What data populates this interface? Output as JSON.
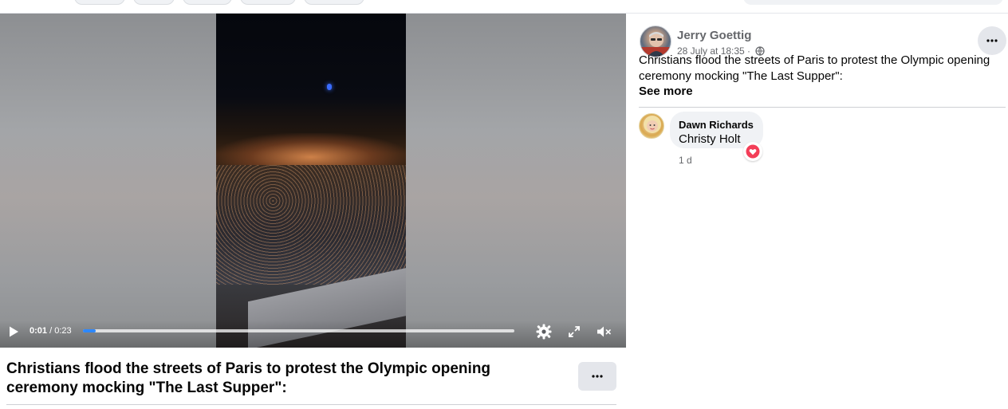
{
  "video": {
    "current_time": "0:01",
    "separator": "/",
    "duration": "0:23",
    "progress_fraction": 0.03,
    "play_icon": "play-icon",
    "settings_icon": "gear-icon",
    "fullscreen_icon": "fullscreen-icon",
    "mute_icon": "muted-speaker-icon"
  },
  "caption": {
    "text": "Christians flood the streets of Paris to protest the Olympic opening ceremony mocking \"The Last Supper\":",
    "more_icon": "more-dots-icon"
  },
  "post": {
    "author": "Jerry Goettig",
    "timestamp": "28 July at 18:35 ·",
    "privacy_icon": "globe-icon",
    "text": "Christians flood the streets of Paris to protest the Olympic opening ceremony mocking \"The Last Supper\":",
    "see_more": "See more",
    "more_icon": "more-dots-icon"
  },
  "comment": {
    "author": "Dawn Richards",
    "text": "Christy Holt",
    "age": "1 d",
    "reaction_icon": "heart-reaction-icon"
  },
  "colors": {
    "accent": "#2d88ff",
    "secondary_text": "#65676b",
    "bubble_bg": "#f0f2f5",
    "love_reaction": "#f33e58"
  }
}
